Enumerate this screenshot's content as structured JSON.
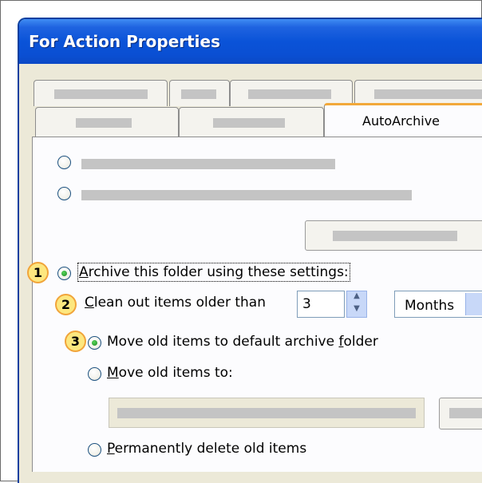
{
  "window": {
    "title": "For Action Properties"
  },
  "tabs": {
    "active_label": "AutoArchive"
  },
  "archive_setting": {
    "badge": "1",
    "label": "Archive this folder using these settings:"
  },
  "clean_out": {
    "badge": "2",
    "label": "Clean out items older than",
    "value": "3",
    "unit": "Months"
  },
  "move_default": {
    "badge": "3",
    "label": "Move old items to default archive folder"
  },
  "move_to": {
    "label": "Move old items to:"
  },
  "delete": {
    "label": "Permanently delete old items"
  },
  "icons": [
    "arrow-up-icon",
    "arrow-down-icon"
  ]
}
